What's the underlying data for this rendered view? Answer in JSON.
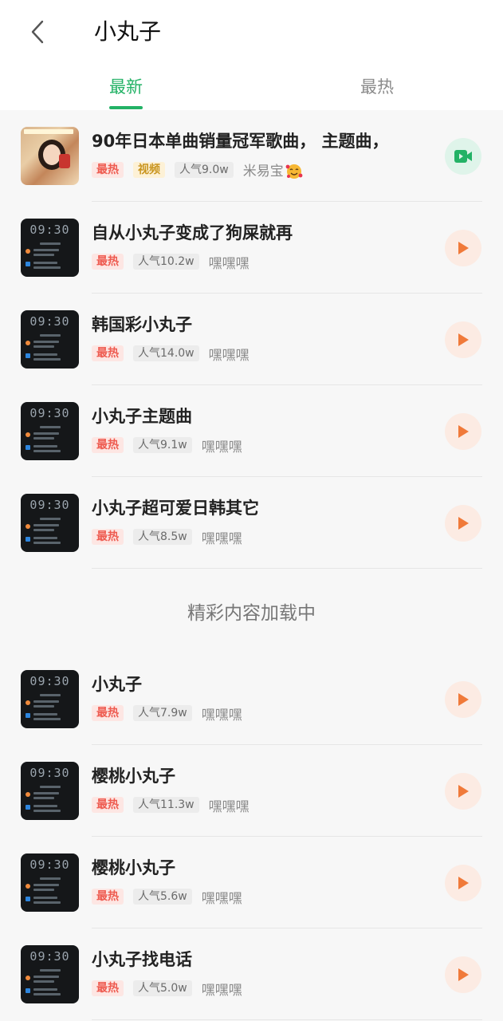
{
  "header": {
    "title": "小丸子",
    "tabs": [
      {
        "label": "最新",
        "active": true
      },
      {
        "label": "最热",
        "active": false
      }
    ],
    "accent_color": "#23b266"
  },
  "items": [
    {
      "title": "90年日本单曲销量冠军歌曲，  主题曲，",
      "badges": [
        "最热",
        "视频"
      ],
      "popularity": "人气9.0w",
      "author": "米易宝",
      "author_emoji": "smiling-face-with-hearts",
      "thumb": "photo",
      "action": "video"
    },
    {
      "title": "自从小丸子变成了狗屎就再",
      "badges": [
        "最热"
      ],
      "popularity": "人气10.2w",
      "author": "嘿嘿嘿",
      "thumb": "clock",
      "action": "play"
    },
    {
      "title": "韩国彩小丸子",
      "badges": [
        "最热"
      ],
      "popularity": "人气14.0w",
      "author": "嘿嘿嘿",
      "thumb": "clock",
      "action": "play"
    },
    {
      "title": "小丸子主题曲",
      "badges": [
        "最热"
      ],
      "popularity": "人气9.1w",
      "author": "嘿嘿嘿",
      "thumb": "clock",
      "action": "play"
    },
    {
      "title": "小丸子超可爱日韩其它",
      "badges": [
        "最热"
      ],
      "popularity": "人气8.5w",
      "author": "嘿嘿嘿",
      "thumb": "clock",
      "action": "play"
    }
  ],
  "loading_text": "精彩内容加载中",
  "items_after": [
    {
      "title": "小丸子",
      "badges": [
        "最热"
      ],
      "popularity": "人气7.9w",
      "author": "嘿嘿嘿",
      "thumb": "clock",
      "action": "play"
    },
    {
      "title": "樱桃小丸子",
      "badges": [
        "最热"
      ],
      "popularity": "人气11.3w",
      "author": "嘿嘿嘿",
      "thumb": "clock",
      "action": "play"
    },
    {
      "title": "樱桃小丸子",
      "badges": [
        "最热"
      ],
      "popularity": "人气5.6w",
      "author": "嘿嘿嘿",
      "thumb": "clock",
      "action": "play"
    },
    {
      "title": "小丸子找电话",
      "badges": [
        "最热"
      ],
      "popularity": "人气5.0w",
      "author": "嘿嘿嘿",
      "thumb": "clock",
      "action": "play"
    }
  ],
  "thumb_clock_text": "09:30",
  "colors": {
    "hot_badge": "#ee5b50",
    "video_badge": "#c9951f",
    "play": "#f07a3a",
    "video_icon": "#23b266"
  }
}
